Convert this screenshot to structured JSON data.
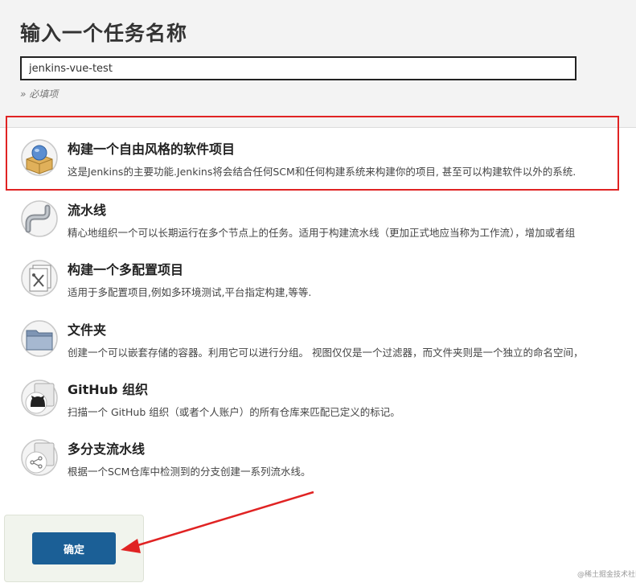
{
  "page": {
    "title": "输入一个任务名称",
    "item_name_value": "jenkins-vue-test",
    "required_hint": "» 必填项"
  },
  "item_types": [
    {
      "icon": "freestyle-project-icon",
      "title": "构建一个自由风格的软件项目",
      "description": "这是Jenkins的主要功能.Jenkins将会结合任何SCM和任何构建系统来构建你的项目, 甚至可以构建软件以外的系统."
    },
    {
      "icon": "pipeline-icon",
      "title": "流水线",
      "description": "精心地组织一个可以长期运行在多个节点上的任务。适用于构建流水线（更加正式地应当称为工作流），增加或者组"
    },
    {
      "icon": "multi-config-icon",
      "title": "构建一个多配置项目",
      "description": "适用于多配置项目,例如多环境测试,平台指定构建,等等."
    },
    {
      "icon": "folder-icon",
      "title": "文件夹",
      "description": "创建一个可以嵌套存储的容器。利用它可以进行分组。 视图仅仅是一个过滤器，而文件夹则是一个独立的命名空间，"
    },
    {
      "icon": "github-org-icon",
      "title": "GitHub 组织",
      "description": "扫描一个 GitHub 组织（或者个人账户）的所有仓库来匹配已定义的标记。"
    },
    {
      "icon": "multibranch-pipeline-icon",
      "title": "多分支流水线",
      "description": "根据一个SCM仓库中检测到的分支创建一系列流水线。"
    }
  ],
  "footer": {
    "ok_label": "确定"
  },
  "watermark": "@稀土掘金技术社区",
  "colors": {
    "highlight": "#e02323",
    "button": "#1b5f96",
    "panel": "#f3f3f3"
  }
}
